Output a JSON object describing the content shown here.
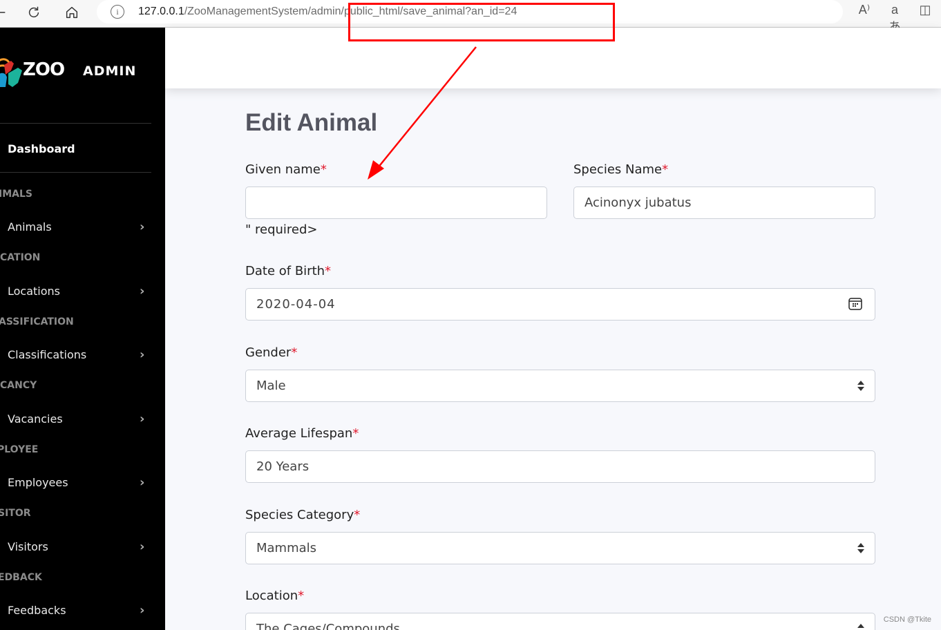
{
  "browser": {
    "url_host": "127.0.0.1",
    "url_path": "/ZooManagementSystem/admin/public_html/save_animal?an_id=24",
    "icons": [
      "back-icon",
      "reload-icon",
      "home-icon",
      "site-info-icon",
      "read-aloud-icon",
      "translate-icon",
      "split-screen-icon"
    ],
    "read_aloud_glyph": "A⁾",
    "translate_glyph": "aあ",
    "split_glyph": "◫"
  },
  "sidebar": {
    "logo_text": "ZOO",
    "brand": "ADMIN",
    "dashboard": "Dashboard",
    "sections": [
      {
        "heading": "ANIMALS",
        "visible_heading": "IMALS",
        "item": "Animals"
      },
      {
        "heading": "LOCATION",
        "visible_heading": "CATION",
        "item": "Locations"
      },
      {
        "heading": "CLASSIFICATION",
        "visible_heading": "ASSIFICATION",
        "item": "Classifications"
      },
      {
        "heading": "VACANCY",
        "visible_heading": "CANCY",
        "item": "Vacancies"
      },
      {
        "heading": "EMPLOYEE",
        "visible_heading": "PLOYEE",
        "item": "Employees"
      },
      {
        "heading": "VISITOR",
        "visible_heading": "SITOR",
        "item": "Visitors"
      },
      {
        "heading": "FEEDBACK",
        "visible_heading": "EDBACK",
        "item": "Feedbacks"
      }
    ],
    "chevron": "›"
  },
  "form": {
    "title": "Edit Animal",
    "required_mark": "*",
    "given_name": {
      "label": "Given name",
      "value": "",
      "stray_text": "\" required>"
    },
    "species_name": {
      "label": "Species Name",
      "value": "Acinonyx jubatus"
    },
    "date_of_birth": {
      "label": "Date of Birth",
      "value": "2020-04-04"
    },
    "gender": {
      "label": "Gender",
      "value": "Male"
    },
    "average_lifespan": {
      "label": "Average Lifespan",
      "value": "20 Years"
    },
    "species_category": {
      "label": "Species Category",
      "value": "Mammals"
    },
    "location": {
      "label": "Location",
      "value": "The Cages/Compounds"
    }
  },
  "colors": {
    "sidebar_bg": "#000000",
    "required": "#e0192c",
    "annotation": "#ff0000"
  },
  "watermark": "CSDN @Tkite"
}
